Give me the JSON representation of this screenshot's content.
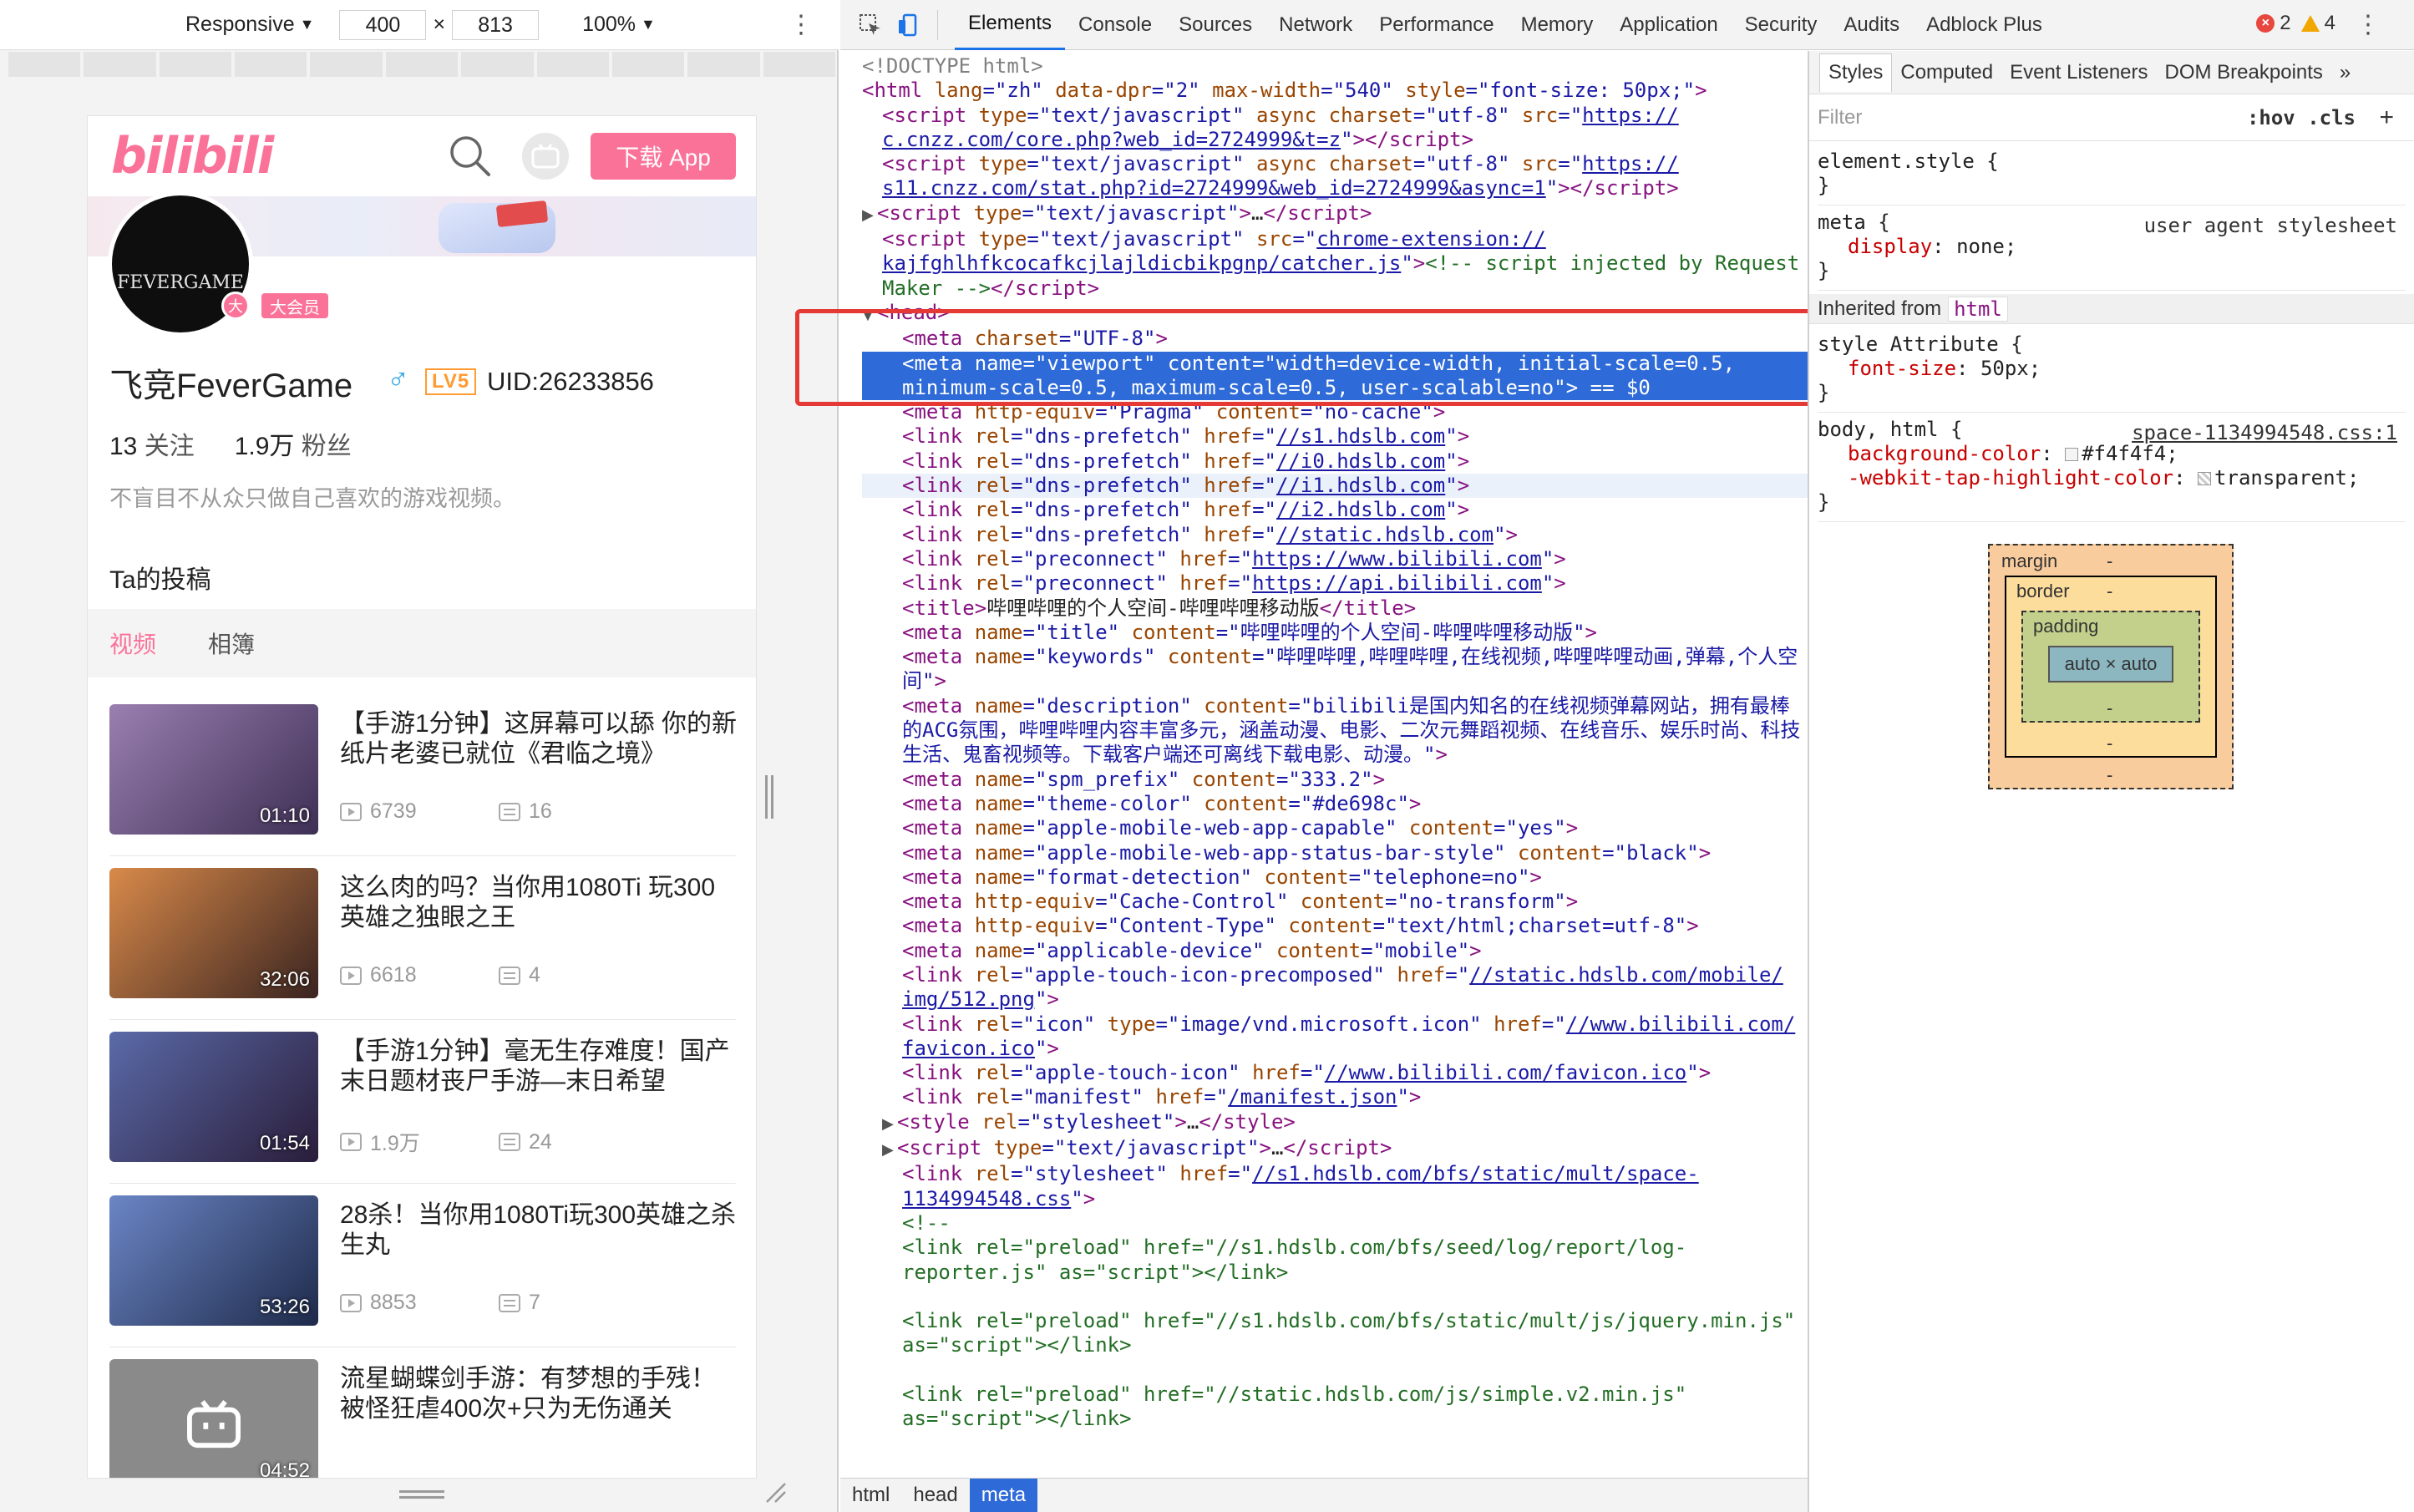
{
  "device_toolbar": {
    "mode": "Responsive",
    "width": "400",
    "times": "×",
    "height": "813",
    "zoom": "100%"
  },
  "phone": {
    "logo": "bilibili",
    "download_label": "下载 App",
    "avatar_text": "FEVERGAME",
    "verify_mark": "大",
    "vip_badge": "大会员",
    "user_name": "飞竞FeverGame",
    "gender": "♂",
    "level": "LV5",
    "uid": "UID:26233856",
    "follow_count": "13",
    "follow_label": "关注",
    "fans_count": "1.9万",
    "fans_label": "粉丝",
    "bio": "不盲目不从众只做自己喜欢的游戏视频。",
    "posts_title": "Ta的投稿",
    "tabs": [
      "视频",
      "相簿"
    ],
    "videos": [
      {
        "title": "【手游1分钟】这屏幕可以舔 你的新纸片老婆已就位《君临之境》",
        "duration": "01:10",
        "plays": "6739",
        "danmaku": "16",
        "color": "#6e5a7a"
      },
      {
        "title": "这么肉的吗？当你用1080Ti 玩300英雄之独眼之王",
        "duration": "32:06",
        "plays": "6618",
        "danmaku": "4",
        "color": "#7a4a3a"
      },
      {
        "title": "【手游1分钟】毫无生存难度！国产末日题材丧尸手游—末日希望",
        "duration": "01:54",
        "plays": "1.9万",
        "danmaku": "24",
        "color": "#3b3f6a"
      },
      {
        "title": "28杀！当你用1080Ti玩300英雄之杀生丸",
        "duration": "53:26",
        "plays": "8853",
        "danmaku": "7",
        "color": "#3a4d77"
      },
      {
        "title": "流星蝴蝶剑手游：有梦想的手残！被怪狂虐400次+只为无伤通关",
        "duration": "04:52",
        "plays": "",
        "danmaku": "",
        "color": "#8a8a8a"
      }
    ]
  },
  "devtools": {
    "tabs": [
      "Elements",
      "Console",
      "Sources",
      "Network",
      "Performance",
      "Memory",
      "Application",
      "Security",
      "Audits",
      "Adblock Plus"
    ],
    "errors": "2",
    "warnings": "4",
    "breadcrumbs": [
      "html",
      "head",
      "meta"
    ]
  },
  "styles": {
    "tabs": [
      "Styles",
      "Computed",
      "Event Listeners",
      "DOM Breakpoints"
    ],
    "more": "»",
    "filter_placeholder": "Filter",
    "filter_opts": ":hov .cls",
    "plus": "+",
    "element_style": "element.style {",
    "close_brace": "}",
    "meta_selector": "meta {",
    "meta_src": "user agent stylesheet",
    "meta_prop": "display",
    "meta_val": "none;",
    "inherited_from": "Inherited from",
    "inherited_tag": "html",
    "style_attr": "style Attribute {",
    "fs_prop": "font-size",
    "fs_val": "50px;",
    "body_selector": "body, html {",
    "body_src": "space-1134994548.css:1",
    "bg_prop": "background-color",
    "bg_val": "#f4f4f4;",
    "tap_prop": "-webkit-tap-highlight-color",
    "tap_val": "transparent;",
    "box_model": {
      "margin": "margin",
      "border": "border",
      "padding": "padding",
      "content": "auto × auto",
      "dash": "-"
    }
  },
  "colors": {
    "bili_pink": "#fb7299",
    "selection_blue": "#2e6ad8",
    "highlight_red": "#e53935"
  }
}
